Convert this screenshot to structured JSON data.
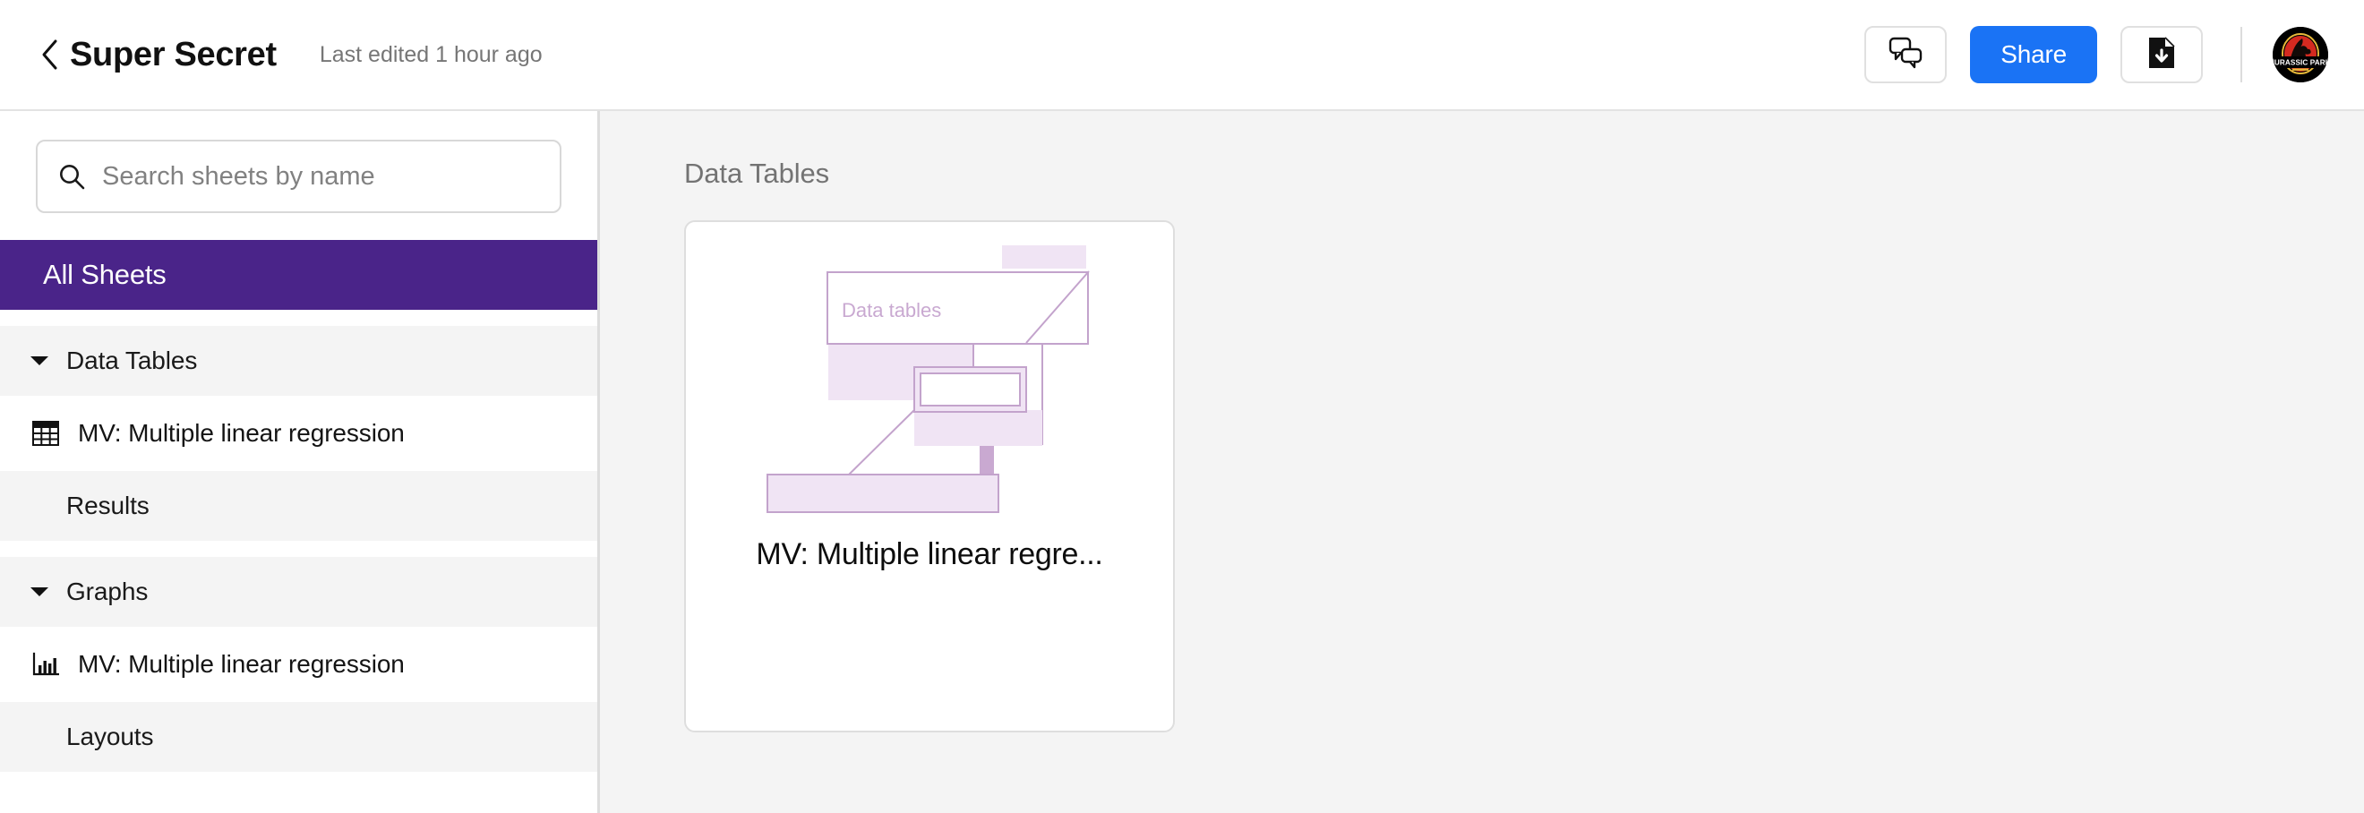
{
  "header": {
    "back_icon": "chevron-left-icon",
    "doc_title": "Super Secret",
    "last_edited": "Last edited 1 hour ago",
    "comments_icon": "comments-bubbles-icon",
    "share_label": "Share",
    "download_icon": "file-download-icon",
    "avatar_label": "JURASSIC PARK"
  },
  "sidebar": {
    "search": {
      "icon": "search-icon",
      "placeholder": "Search sheets by name",
      "value": ""
    },
    "all_sheets_label": "All Sheets",
    "groups": [
      {
        "label": "Data Tables",
        "expanded": true,
        "has_chevron": true,
        "items": [
          {
            "label": "MV: Multiple linear regression",
            "icon": "table-grid-icon"
          }
        ]
      },
      {
        "label": "Results",
        "expanded": false,
        "has_chevron": false,
        "items": []
      },
      {
        "label": "Graphs",
        "expanded": true,
        "has_chevron": true,
        "items": [
          {
            "label": "MV: Multiple linear regression",
            "icon": "bar-chart-icon"
          }
        ]
      },
      {
        "label": "Layouts",
        "expanded": false,
        "has_chevron": false,
        "items": []
      }
    ]
  },
  "main": {
    "section_title": "Data Tables",
    "cards": [
      {
        "title": "MV: Multiple linear regre...",
        "thumbnail_label": "Data tables",
        "thumbnail_icon": "data-table-illustration"
      }
    ]
  },
  "colors": {
    "accent_purple": "#4A2489",
    "share_blue": "#1A73F5",
    "thumb_fill": "#F0E4F4",
    "thumb_stroke": "#C3A3CC",
    "main_bg": "#F4F4F4",
    "group_bg": "#F4F4F4"
  }
}
